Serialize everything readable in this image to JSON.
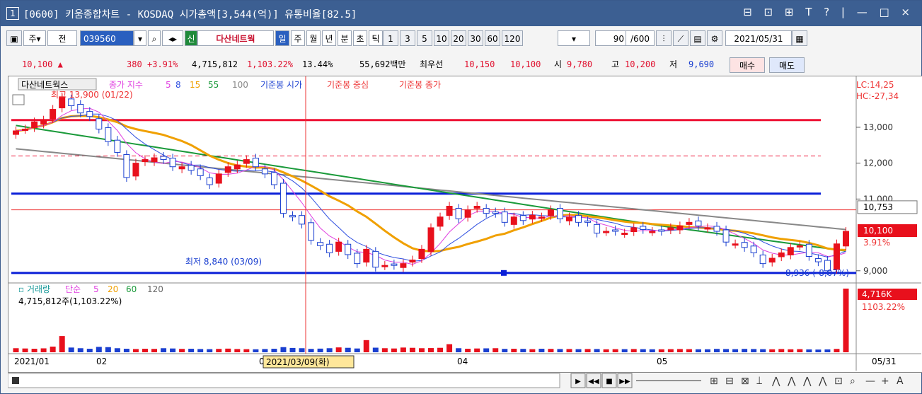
{
  "window": {
    "number": "1",
    "title": "[0600] 키움종합차트 - KOSDAQ 시가총액[3,544(억)] 유통비율[82.5]",
    "controls": "⊟ ⊡ ⊞ T ? | — □ ×"
  },
  "toolbar": {
    "mode1": "주",
    "mode2": "전",
    "code": "039560",
    "stock_name": "다산네트웍",
    "periods": [
      "일",
      "주",
      "월",
      "년",
      "분",
      "초",
      "틱"
    ],
    "active_period": "일",
    "intervals": [
      "1",
      "3",
      "5",
      "10",
      "20",
      "30",
      "60",
      "120"
    ],
    "count": "90",
    "count_max": "/600",
    "date": "2021/05/31"
  },
  "quote": {
    "price": "10,100",
    "change_symbol": "▲",
    "change": "380",
    "change_pct": "+3.91%",
    "volume": "4,715,812",
    "volume_ratio": "1,103.22%",
    "turnover": "13.44%",
    "amount": "55,692백만",
    "best_label": "최우선",
    "ask": "10,150",
    "bid": "10,100",
    "open_label": "시",
    "open": "9,780",
    "high_label": "고",
    "high": "10,200",
    "low_label": "저",
    "low": "9,690",
    "buy": "매수",
    "sell": "매도"
  },
  "chart_data": [
    {
      "type": "candlestick",
      "title": "다산네트웍스",
      "legend": [
        "종가 지수",
        "5",
        "8",
        "15",
        "55",
        "100",
        "기준봉 시가",
        "기준봉 중심",
        "기준봉 종가"
      ],
      "ylim": [
        8700,
        14300
      ],
      "yticks": [
        "13,000",
        "12,000",
        "11,000",
        "9,000"
      ],
      "corner_labels": [
        "LC:14,25",
        "HC:-27,34"
      ],
      "annotations": {
        "high": "최고 13,900 (01/22)",
        "low": "최저 8,840 (03/09)",
        "low_value": "8,936 (-8,07%)",
        "last_price": "10,100",
        "last_pct": "3.91%",
        "ref_price": "10,753"
      },
      "hlines": {
        "red_thick": 13200,
        "red_dashed": 12200,
        "red_thin": 10700,
        "blue_upper": 11150,
        "blue_lower": 8940
      },
      "closes": [
        12900,
        12950,
        13150,
        13200,
        13500,
        13850,
        13600,
        13400,
        13300,
        12950,
        12600,
        12300,
        11600,
        12000,
        12100,
        12150,
        12100,
        11900,
        11900,
        11800,
        11650,
        11400,
        11700,
        11900,
        11950,
        12100,
        11900,
        11700,
        11400,
        10600,
        10500,
        10300,
        9850,
        9700,
        9500,
        9800,
        9450,
        9200,
        9600,
        9100,
        9150,
        9150,
        9200,
        9300,
        9600,
        10200,
        10500,
        10800,
        10450,
        10700,
        10800,
        10600,
        10600,
        10350,
        10500,
        10400,
        10550,
        10500,
        10700,
        10450,
        10500,
        10350,
        10350,
        10050,
        10100,
        10100,
        10050,
        10200,
        10150,
        10100,
        10100,
        10200,
        10250,
        10350,
        10250,
        10200,
        10100,
        9800,
        9750,
        9650,
        9500,
        9200,
        9350,
        9500,
        9650,
        9700,
        9400,
        9250,
        9000,
        9750,
        10100
      ],
      "date_labels": [
        "2021/01",
        "02",
        "03",
        "04",
        "05",
        "05/31"
      ],
      "crosshair_date": "2021/03/09(화)"
    },
    {
      "type": "bar",
      "title": "거래량",
      "legend": [
        "단순",
        "5",
        "20",
        "60",
        "120"
      ],
      "current": "4,715,812주(1,103.22%)",
      "last_label": "4,716K",
      "last_pct": "1103.22%",
      "values": [
        300,
        280,
        260,
        290,
        420,
        1200,
        350,
        300,
        260,
        400,
        380,
        300,
        260,
        240,
        260,
        250,
        300,
        280,
        250,
        260,
        240,
        230,
        250,
        270,
        240,
        230,
        220,
        240,
        260,
        380,
        320,
        300,
        250,
        270,
        300,
        360,
        330,
        280,
        900,
        340,
        300,
        280,
        350,
        330,
        300,
        310,
        330,
        600,
        300,
        260,
        280,
        290,
        300,
        250,
        260,
        250,
        230,
        260,
        250,
        240,
        240,
        230,
        240,
        240,
        220,
        230,
        230,
        240,
        230,
        220,
        220,
        230,
        240,
        230,
        220,
        220,
        250,
        240,
        230,
        250,
        240,
        230,
        220,
        240,
        220,
        230,
        210,
        200,
        210,
        250,
        4716
      ]
    }
  ]
}
